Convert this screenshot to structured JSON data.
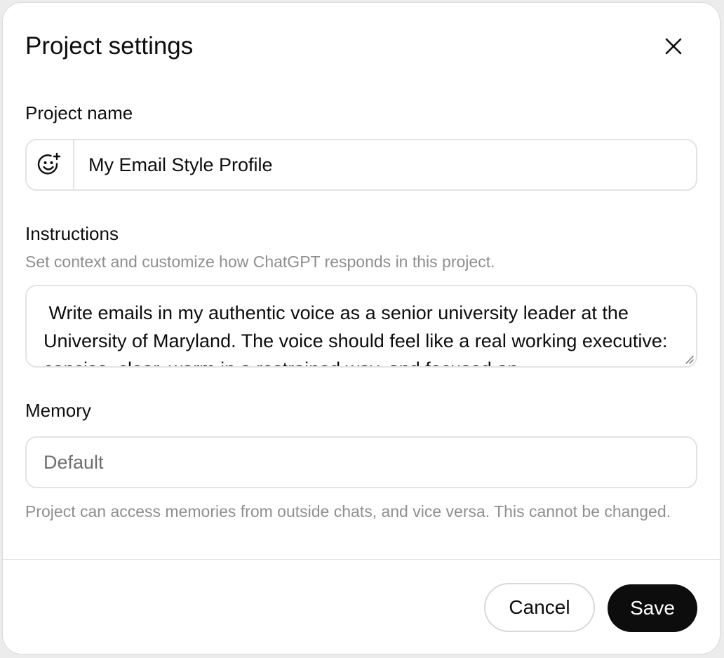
{
  "dialog": {
    "title": "Project settings",
    "close_icon": "close-icon"
  },
  "project_name": {
    "label": "Project name",
    "emoji_icon": "add-emoji-icon",
    "value": "My Email Style Profile"
  },
  "instructions": {
    "label": "Instructions",
    "hint": "Set context and customize how ChatGPT responds in this project.",
    "value": " Write emails in my authentic voice as a senior university leader at the University of Maryland. The voice should feel like a real working executive: concise, clear, warm in a restrained way, and focused on"
  },
  "memory": {
    "label": "Memory",
    "value": "Default",
    "note": "Project can access memories from outside chats, and vice versa. This cannot be changed."
  },
  "footer": {
    "cancel_label": "Cancel",
    "save_label": "Save",
    "save_color": "#0d0d0d"
  }
}
